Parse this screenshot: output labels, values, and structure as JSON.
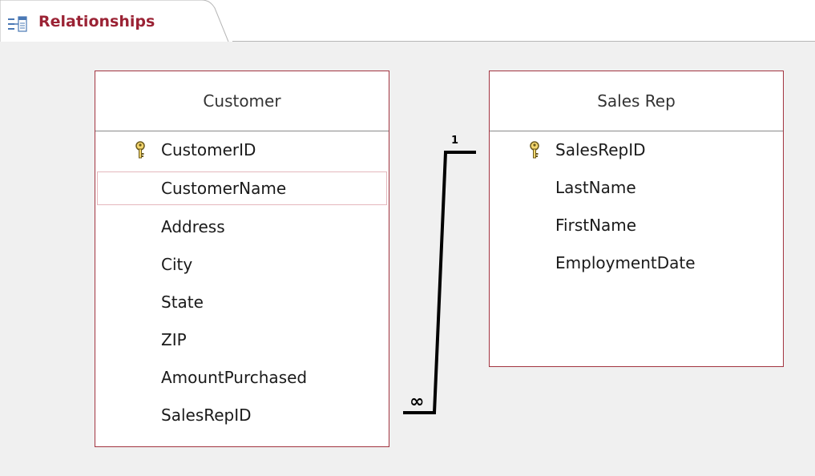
{
  "tab": {
    "label": "Relationships",
    "icon": "relationships-icon"
  },
  "tables": {
    "customer": {
      "name": "Customer",
      "fields": [
        {
          "name": "CustomerID",
          "primary_key": true
        },
        {
          "name": "CustomerName",
          "selected": true
        },
        {
          "name": "Address"
        },
        {
          "name": "City"
        },
        {
          "name": "State"
        },
        {
          "name": "ZIP"
        },
        {
          "name": "AmountPurchased"
        },
        {
          "name": "SalesRepID"
        }
      ]
    },
    "sales_rep": {
      "name": "Sales Rep",
      "fields": [
        {
          "name": "SalesRepID",
          "primary_key": true
        },
        {
          "name": "LastName"
        },
        {
          "name": "FirstName"
        },
        {
          "name": "EmploymentDate"
        }
      ]
    }
  },
  "relationship": {
    "one_label": "1",
    "many_label": "∞",
    "from": "Sales Rep.SalesRepID",
    "to": "Customer.SalesRepID"
  },
  "colors": {
    "accent": "#9b2335",
    "table_border": "#a23440",
    "canvas_bg": "#f0f0f0"
  }
}
